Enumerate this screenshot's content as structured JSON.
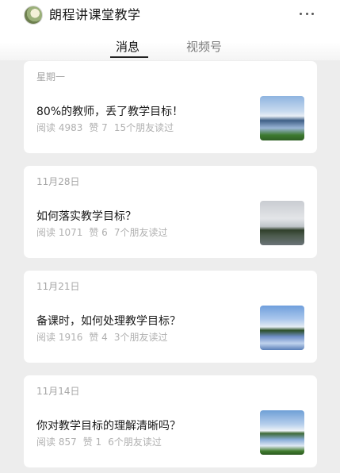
{
  "header": {
    "account_name": "朗程讲课堂教学",
    "avatar_icon": "account-avatar",
    "more_icon": "more-dots-icon"
  },
  "tabs": [
    {
      "label": "消息",
      "active": true
    },
    {
      "label": "视频号",
      "active": false
    }
  ],
  "articles": [
    {
      "date": "星期一",
      "title": "80%的教师，丢了教学目标！",
      "reads": "阅读 4983",
      "likes": "赞 7",
      "friends": "15个朋友读过"
    },
    {
      "date": "11月28日",
      "title": "如何落实教学目标？",
      "reads": "阅读 1071",
      "likes": "赞 6",
      "friends": "7个朋友读过"
    },
    {
      "date": "11月21日",
      "title": "备课时，如何处理教学目标？",
      "reads": "阅读 1916",
      "likes": "赞 4",
      "friends": "3个朋友读过"
    },
    {
      "date": "11月14日",
      "title": "你对教学目标的理解清晰吗？",
      "reads": "阅读 857",
      "likes": "赞 1",
      "friends": "6个朋友读过"
    }
  ]
}
